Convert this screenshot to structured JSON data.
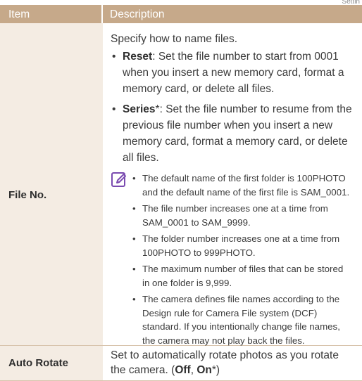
{
  "corner_text": "Settin",
  "table": {
    "header_item": "Item",
    "header_description": "Description",
    "file_no": {
      "item": "File No.",
      "intro": "Specify how to name files.",
      "reset_term": "Reset",
      "reset_text": ": Set the file number to start from 0001 when you insert a new memory card, format a memory card, or delete all files.",
      "series_term": "Series",
      "series_text": "*: Set the file number to resume from the previous file number when you insert a new memory card, format a memory card, or delete all files.",
      "notes": [
        "The default name of the first folder is 100PHOTO and the default name of the first file is SAM_0001.",
        "The file number increases one at a time from SAM_0001 to SAM_9999.",
        "The folder number increases one at a time from 100PHOTO to 999PHOTO.",
        "The maximum number of files that can be stored in one folder is 9,999.",
        "The camera defines file names according to the Design rule for Camera File system (DCF) standard. If you intentionally change file names, the camera may not play back the files."
      ]
    },
    "auto_rotate": {
      "item": "Auto Rotate",
      "text_before": "Set to automatically rotate photos as you rotate the camera. (",
      "off": "Off",
      "separator": ", ",
      "on": "On",
      "text_after": "*)"
    }
  },
  "colors": {
    "header_bg": "#c6a98a",
    "item_cell_bg": "#f4ece3",
    "note_icon": "#7a4bb0"
  },
  "icons": {
    "note": "note-pencil-icon"
  }
}
